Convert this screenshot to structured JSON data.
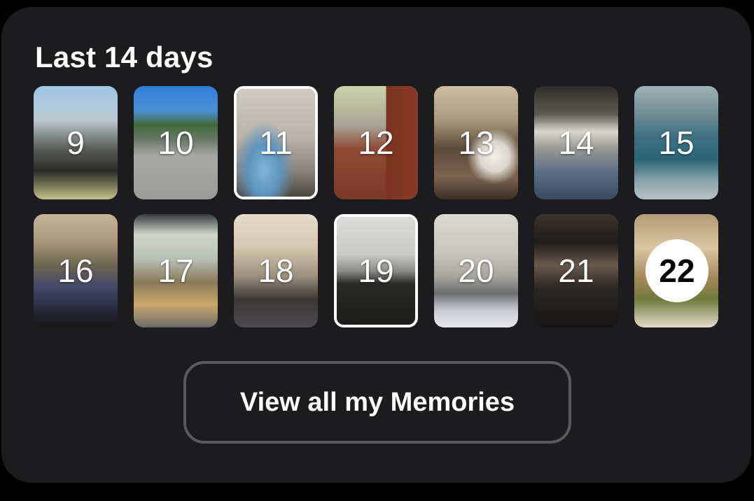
{
  "section": {
    "title": "Last 14 days"
  },
  "days": [
    {
      "label": "9",
      "thumb": "car interior with steering wheel and sky"
    },
    {
      "label": "10",
      "thumb": "person standing by a road under blue sky"
    },
    {
      "label": "11",
      "thumb": "blue shark plush toy in a room",
      "selected": true
    },
    {
      "label": "12",
      "thumb": "brick walkway with person walking"
    },
    {
      "label": "13",
      "thumb": "friends at a dining table"
    },
    {
      "label": "14",
      "thumb": "lounge with chairs"
    },
    {
      "label": "15",
      "thumb": "indoor swimming pool"
    },
    {
      "label": "16",
      "thumb": "laptop screen in dim room"
    },
    {
      "label": "17",
      "thumb": "desk with monitors and keyboard"
    },
    {
      "label": "18",
      "thumb": "dorm room with person"
    },
    {
      "label": "19",
      "thumb": "laptop on desk",
      "selected": true
    },
    {
      "label": "20",
      "thumb": "room with person lying down"
    },
    {
      "label": "21",
      "thumb": "restaurant counter"
    },
    {
      "label": "22",
      "thumb": "meal on a table",
      "today": true
    }
  ],
  "button": {
    "label": "View all my Memories"
  }
}
